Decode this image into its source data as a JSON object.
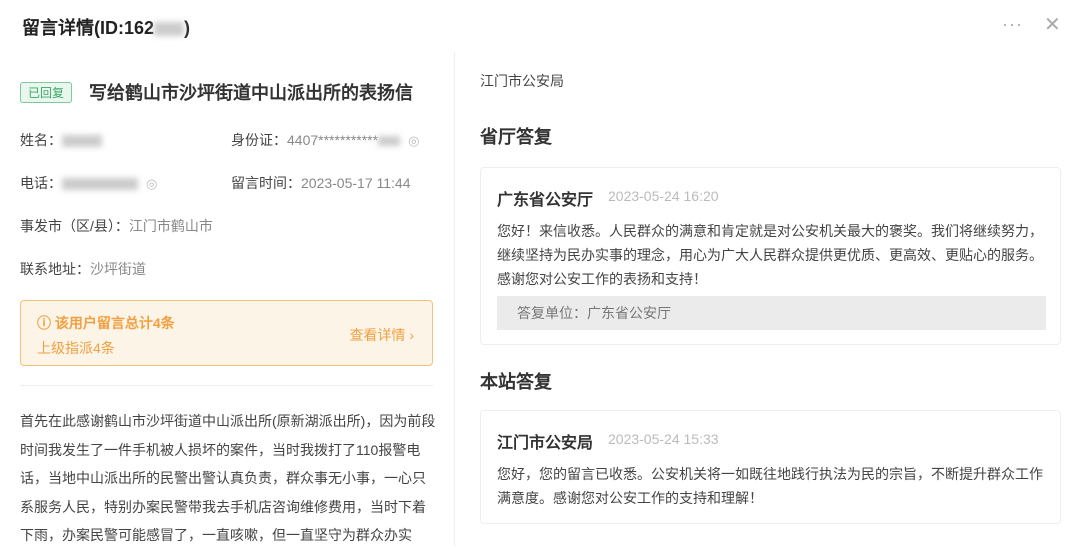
{
  "header": {
    "title": "留言详情(ID:162",
    "title_end": ")",
    "more": "···",
    "close": "✕"
  },
  "message": {
    "status": "已回复",
    "title": "写给鹤山市沙坪街道中山派出所的表扬信",
    "name_label": "姓名：",
    "id_label": "身份证：",
    "id_value": "4407***********",
    "phone_label": "电话：",
    "time_label": "留言时间：",
    "time_value": "2023-05-17 11:44",
    "city_label": "事发市（区/县）：",
    "city_value": "江门市鹤山市",
    "address_label": "联系地址：",
    "address_value": "沙坪街道",
    "notice": {
      "title": "该用户留言总计4条",
      "sub": "上级指派4条",
      "link": "查看详情"
    },
    "body_lines": [
      "首先在此感谢鹤山市沙坪街道中山派出所(原新湖派出所)，因为前段",
      "时间我发生了一件手机被人损坏的案件，当时我拨打了110报警电",
      "话，当地中山派出所的民警出警认真负责，群众事无小事，一心只",
      "系服务人民，特别办案民警带我去手机店咨询维修费用，当时下着",
      "下雨，办案民警可能感冒了，一直咳嗽，但一直坚守为群众办实"
    ]
  },
  "right": {
    "org": "江门市公安局",
    "province_section": "省厅答复",
    "province_reply": {
      "name": "广东省公安厅",
      "time": "2023-05-24 16:20",
      "lines": [
        "您好！来信收悉。人民群众的满意和肯定就是对公安机关最大的褒奖。我们将继续努力，",
        "继续坚持为民办实事的理念，用心为广大人民群众提供更优质、更高效、更贴心的服务。",
        "感谢您对公安工作的表扬和支持！"
      ],
      "unit": "答复单位：广东省公安厅"
    },
    "site_section": "本站答复",
    "site_reply": {
      "name": "江门市公安局",
      "time": "2023-05-24 15:33",
      "lines": [
        "您好，您的留言已收悉。公安机关将一如既往地践行执法为民的宗旨，不断提升群众工作",
        "满意度。感谢您对公安工作的支持和理解！"
      ]
    }
  }
}
